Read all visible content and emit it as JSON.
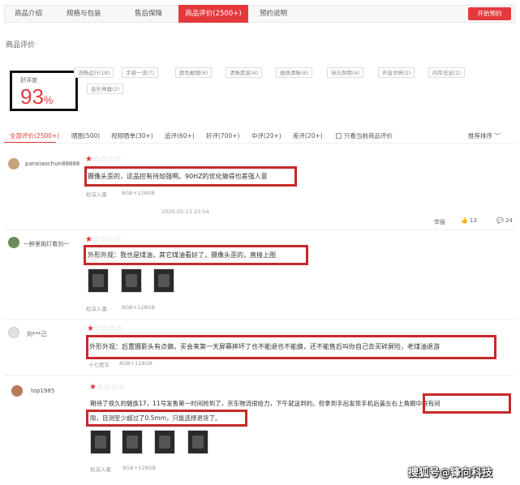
{
  "tabs": [
    {
      "label": "商品介绍"
    },
    {
      "label": "规格与包装"
    },
    {
      "label": "售后保障"
    },
    {
      "label": "商品评价(2500+)"
    },
    {
      "label": "预约说明"
    }
  ],
  "cta_label": "开始预约",
  "section_title": "商品评价",
  "rating": {
    "label": "好评度",
    "value": "93",
    "unit": "%"
  },
  "tags": [
    "流畅运行(18)",
    "手感一流(7)",
    "颜色靓丽(6)",
    "清晰度高(6)",
    "画质清晰(6)",
    "待久耐用(4)",
    "声音洪亮(2)",
    "内存充足(2)",
    "音乐神器(2)"
  ],
  "filters": {
    "all": "全部评价(2500+)",
    "photo": "晒图(500)",
    "video": "视频晒单(30+)",
    "followup": "追评(60+)",
    "good": "好评(700+)",
    "mid": "中评(20+)",
    "bad": "差评(20+)",
    "current_only": "只看当前商品评价",
    "sort": "推荐排序"
  },
  "reviews": [
    {
      "user": "panxiaochun88888",
      "stars": 1,
      "text": "摄像头歪的，这品控有待加强啊。90HZ的优化做得也差强人意",
      "color": "松深入墨",
      "spec": "8GB+128GB",
      "date": "2020-05-13 23:54",
      "report": "举报",
      "likes": "13",
      "comments": "24"
    },
    {
      "user": "一醉里挑灯看剑一",
      "stars": 1,
      "text": "外形外观：我也是煤油，其它煤油看好了，摄像头歪的，直接上图",
      "color": "松深入墨",
      "spec": "8GB+128GB"
    },
    {
      "user": "刘***己",
      "stars": 1,
      "text": "外形外观：后置摄影头有点偏，买会来第一天屏幕摔坏了也不能退也不能换，还不能售后叫你自己去买碎屏险，老煤油退游",
      "color": "十七度灰",
      "spec": "8GB+128GB"
    },
    {
      "user": "top1985",
      "stars": 1,
      "text_line1": "期待了很久的魅族17，11号发售第一时间抢到了，京东物流很给力，下午就送到的。但拿到手后发现手机后盖左右上角跟中框有间",
      "text_line2": "隙，目测至少超过了0.5mm，只能选择退货了。",
      "color": "松深入墨",
      "spec": "8GB+128GB"
    }
  ],
  "watermark": "搜狐号@锋向科技",
  "colors": {
    "accent": "#e4393c",
    "highlight_box": "#c62a2a"
  }
}
